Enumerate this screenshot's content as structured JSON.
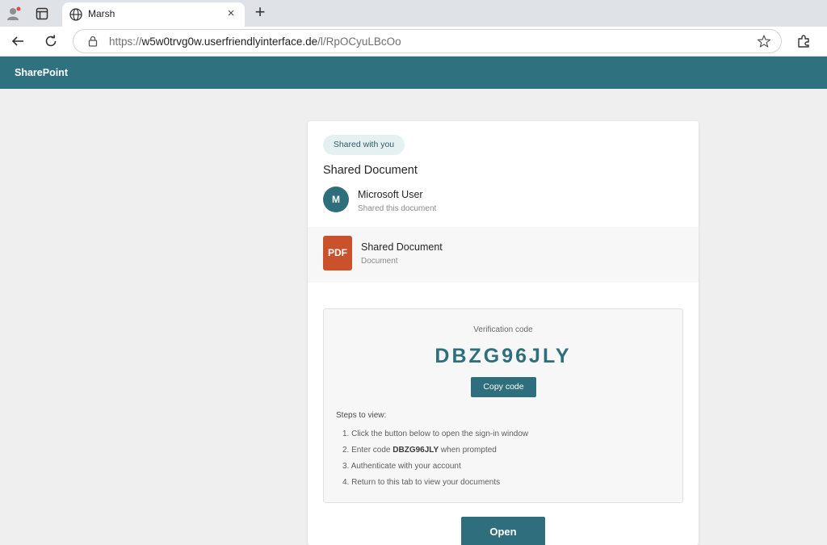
{
  "browser": {
    "tab": {
      "title": "Marsh",
      "close_glyph": "×"
    },
    "new_tab_glyph": "+",
    "address": {
      "scheme": "https://",
      "host": "w5w0trvg0w.userfriendlyinterface.de",
      "path": "/l/RpOCyuLBcOo"
    },
    "icons": {
      "profile": "profile-icon",
      "tab_actions": "tab-actions-icon",
      "favicon": "globe-icon",
      "back": "back-arrow-icon",
      "reload": "reload-icon",
      "lock": "lock-icon",
      "favorite": "star-icon",
      "extensions": "extensions-icon"
    },
    "colors": {
      "profile_dot": "#e5484d"
    }
  },
  "header": {
    "brand": "SharePoint",
    "color": "#2f717f"
  },
  "card": {
    "badge": "Shared with you",
    "title": "Shared Document",
    "sharer": {
      "initial": "M",
      "name": "Microsoft User",
      "subtitle": "Shared this document"
    },
    "file": {
      "icon_label": "PDF",
      "name": "Shared Document",
      "type": "Document"
    },
    "verification": {
      "label": "Verification code",
      "code": "DBZG96JLY",
      "copy_label": "Copy code",
      "steps_title": "Steps to view:",
      "steps": [
        {
          "text": "1. Click the button below to open the sign-in window"
        },
        {
          "before": "2. Enter code ",
          "code": "DBZG96JLY",
          "after": " when prompted"
        },
        {
          "text": "3. Authenticate with your account"
        },
        {
          "text": "4. Return to this tab to view your documents"
        }
      ]
    },
    "open_label": "Open"
  },
  "colors": {
    "accent": "#2f6e7c",
    "pdf": "#c9522d",
    "badge_bg": "#e5f0f1"
  }
}
